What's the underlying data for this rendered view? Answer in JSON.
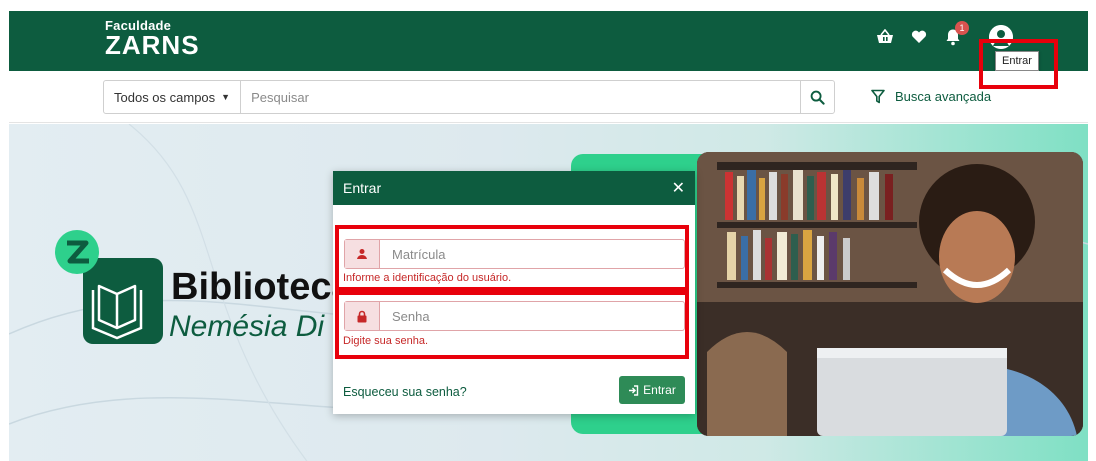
{
  "header": {
    "brand_small": "Faculdade",
    "brand_big": "ZARNS",
    "notification_count": "1",
    "tooltip": "Entrar",
    "icons": [
      "basket-icon",
      "heart-icon",
      "bell-icon",
      "user-icon"
    ]
  },
  "search": {
    "scope_label": "Todos os campos",
    "placeholder": "Pesquisar",
    "advanced_label": "Busca avançada"
  },
  "hero": {
    "title": "Biblioteca",
    "subtitle": "Nemésia Di"
  },
  "modal": {
    "title": "Entrar",
    "user_placeholder": "Matrícula",
    "user_error": "Informe a identificação do usuário.",
    "password_placeholder": "Senha",
    "password_error": "Digite sua senha.",
    "forgot_label": "Esqueceu sua senha?",
    "submit_label": "Entrar"
  },
  "colors": {
    "brand_green": "#0d5c3f",
    "accent_green": "#2ed08c",
    "error_red": "#c62828",
    "highlight_red": "#e8000b"
  }
}
